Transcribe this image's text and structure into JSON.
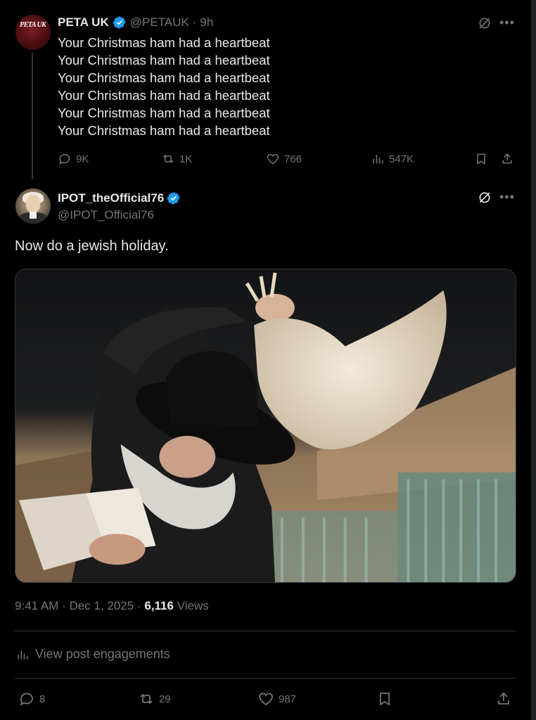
{
  "parent_tweet": {
    "avatar_text": "PETA UK",
    "display_name": "PETA UK",
    "handle": "@PETAUK",
    "separator": "·",
    "time": "9h",
    "lines": [
      "Your Christmas ham had a heartbeat",
      "Your Christmas ham had a heartbeat",
      "Your Christmas ham had a heartbeat",
      "Your Christmas ham had a heartbeat",
      "Your Christmas ham had a heartbeat",
      "Your Christmas ham had a heartbeat"
    ],
    "stats": {
      "replies": "9K",
      "reposts": "1K",
      "likes": "766",
      "views": "547K"
    }
  },
  "reply_tweet": {
    "display_name": "IPOT_theOfficial76",
    "handle": "@IPOT_Official76",
    "text": "Now do a jewish holiday.",
    "meta": {
      "time": "9:41 AM",
      "separator": "·",
      "date": "Dec 1, 2025",
      "view_count": "6,116",
      "views_label": "Views"
    },
    "engagements_label": "View post engagements",
    "stats": {
      "replies": "8",
      "reposts": "29",
      "likes": "987"
    }
  },
  "colors": {
    "background": "#000000",
    "text_primary": "#e7e9ea",
    "text_secondary": "#71767b",
    "verified_blue": "#1d9bf0",
    "divider": "#2f3336"
  },
  "icons": {
    "verified": "verified-badge-icon",
    "grok": "grok-icon",
    "more": "more-icon",
    "reply": "reply-icon",
    "repost": "repost-icon",
    "like": "like-icon",
    "views": "views-icon",
    "bookmark": "bookmark-icon",
    "share": "share-icon"
  }
}
